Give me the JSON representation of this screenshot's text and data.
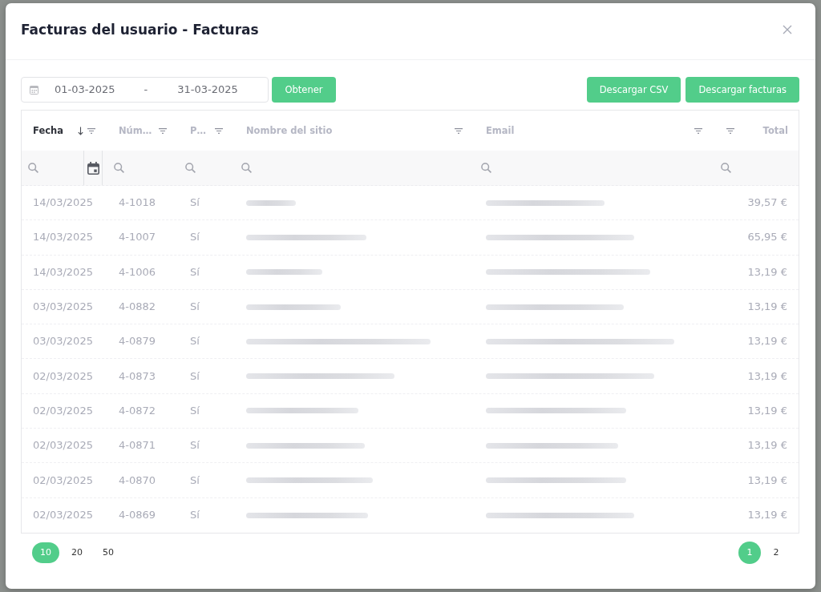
{
  "dialog": {
    "title": "Facturas del usuario - Facturas"
  },
  "toolbar": {
    "date_range": {
      "start": "01-03-2025",
      "separator": "-",
      "end": "31-03-2025"
    },
    "fetch_button": "Obtener",
    "download_buttons": [
      "Descargar CSV",
      "Descargar facturas"
    ]
  },
  "table": {
    "columns": [
      {
        "label": "Fecha",
        "kind": "date",
        "sorted": true,
        "filterable": true
      },
      {
        "label": "Núm…",
        "kind": "number",
        "sorted": false,
        "filterable": true
      },
      {
        "label": "P…",
        "kind": "paid",
        "sorted": false,
        "filterable": true
      },
      {
        "label": "Nombre del sitio",
        "kind": "redacted",
        "sorted": false,
        "filterable": true
      },
      {
        "label": "Email",
        "kind": "redacted",
        "sorted": false,
        "filterable": true
      },
      {
        "kind": "blank",
        "sorted": false,
        "filterable": true
      },
      {
        "label": "Total",
        "kind": "total",
        "sorted": false,
        "filterable": false
      }
    ],
    "rows": [
      {
        "date": "14/03/2025",
        "number": "4-1018",
        "paid": "Sí",
        "total": "39,57 €"
      },
      {
        "date": "14/03/2025",
        "number": "4-1007",
        "paid": "Sí",
        "total": "65,95 €"
      },
      {
        "date": "14/03/2025",
        "number": "4-1006",
        "paid": "Sí",
        "total": "13,19 €"
      },
      {
        "date": "03/03/2025",
        "number": "4-0882",
        "paid": "Sí",
        "total": "13,19 €"
      },
      {
        "date": "03/03/2025",
        "number": "4-0879",
        "paid": "Sí",
        "total": "13,19 €"
      },
      {
        "date": "02/03/2025",
        "number": "4-0873",
        "paid": "Sí",
        "total": "13,19 €"
      },
      {
        "date": "02/03/2025",
        "number": "4-0872",
        "paid": "Sí",
        "total": "13,19 €"
      },
      {
        "date": "02/03/2025",
        "number": "4-0871",
        "paid": "Sí",
        "total": "13,19 €"
      },
      {
        "date": "02/03/2025",
        "number": "4-0870",
        "paid": "Sí",
        "total": "13,19 €"
      },
      {
        "date": "02/03/2025",
        "number": "4-0869",
        "paid": "Sí",
        "total": "13,19 €"
      }
    ]
  },
  "pagination": {
    "page_sizes": [
      {
        "label": "10",
        "selected": true
      },
      {
        "label": "20",
        "selected": false
      },
      {
        "label": "50",
        "selected": false
      }
    ],
    "pages": [
      {
        "label": "1",
        "selected": true
      },
      {
        "label": "2",
        "selected": false
      }
    ]
  }
}
